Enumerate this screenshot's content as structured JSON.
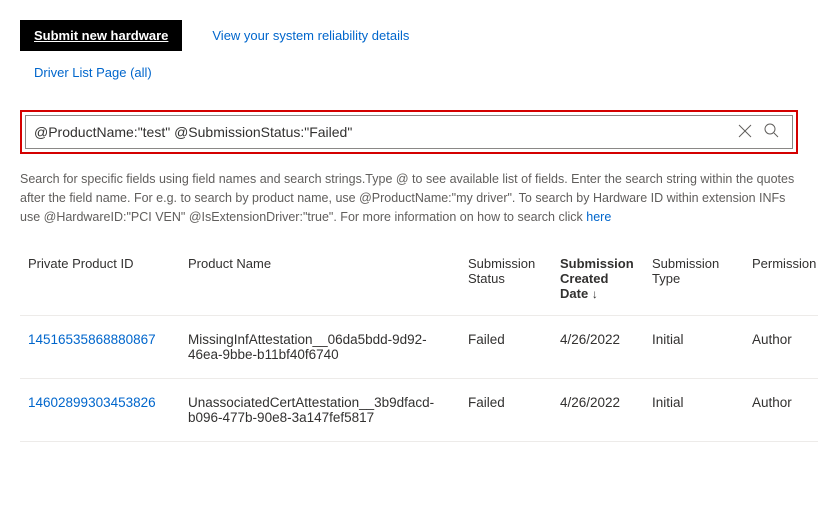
{
  "topLinks": {
    "submitHardware": "Submit new hardware",
    "reliability": "View your system reliability details",
    "driverList": "Driver List Page (all)"
  },
  "search": {
    "value": "@ProductName:\"test\" @SubmissionStatus:\"Failed\""
  },
  "helpText": {
    "part1": "Search for specific fields using field names and search strings.Type @ to see available list of fields. Enter the search string within the quotes after the field name. For e.g. to search by product name, use @ProductName:\"my driver\". To search by Hardware ID within extension INFs use @HardwareID:\"PCI VEN\" @IsExtensionDriver:\"true\". For more information on how to search click ",
    "hereLink": "here"
  },
  "columns": {
    "id": "Private Product ID",
    "name": "Product Name",
    "status": "Submission Status",
    "date": "Submission Created Date",
    "type": "Submission Type",
    "permission": "Permission"
  },
  "sortArrow": "↓",
  "rows": [
    {
      "id": "14516535868880867",
      "name": "MissingInfAttestation__06da5bdd-9d92-46ea-9bbe-b11bf40f6740",
      "status": "Failed",
      "date": "4/26/2022",
      "type": "Initial",
      "permission": "Author"
    },
    {
      "id": "14602899303453826",
      "name": "UnassociatedCertAttestation__3b9dfacd-b096-477b-90e8-3a147fef5817",
      "status": "Failed",
      "date": "4/26/2022",
      "type": "Initial",
      "permission": "Author"
    }
  ]
}
